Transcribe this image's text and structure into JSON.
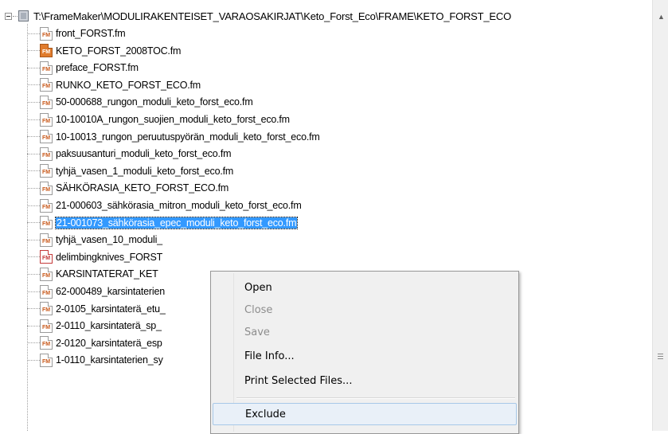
{
  "tree": {
    "root_path": "T:\\FrameMaker\\MODULIRAKENTEISET_VARAOSAKIRJAT\\Keto_Forst_Eco\\FRAME\\KETO_FORST_ECO",
    "files": [
      {
        "name": "front_FORST.fm",
        "icon": "fm-document-icon"
      },
      {
        "name": "KETO_FORST_2008TOC.fm",
        "icon": "fm-toc-icon"
      },
      {
        "name": "preface_FORST.fm",
        "icon": "fm-document-icon"
      },
      {
        "name": "RUNKO_KETO_FORST_ECO.fm",
        "icon": "fm-document-icon"
      },
      {
        "name": "50-000688_rungon_moduli_keto_forst_eco.fm",
        "icon": "fm-document-icon"
      },
      {
        "name": "10-10010A_rungon_suojien_moduli_keto_forst_eco.fm",
        "icon": "fm-document-icon"
      },
      {
        "name": "10-10013_rungon_peruutuspyörän_moduli_keto_forst_eco.fm",
        "icon": "fm-document-icon"
      },
      {
        "name": "paksuusanturi_moduli_keto_forst_eco.fm",
        "icon": "fm-document-icon"
      },
      {
        "name": "tyhjä_vasen_1_moduli_keto_forst_eco.fm",
        "icon": "fm-document-icon"
      },
      {
        "name": "SÄHKÖRASIA_KETO_FORST_ECO.fm",
        "icon": "fm-document-icon"
      },
      {
        "name": "21-000603_sähkörasia_mitron_moduli_keto_forst_eco.fm",
        "icon": "fm-document-icon"
      },
      {
        "name": "21-001073_sähkörasia_epec_moduli_keto_forst_eco.fm",
        "icon": "fm-document-icon",
        "selected": true
      },
      {
        "name": "tyhjä_vasen_10_moduli_",
        "icon": "fm-document-icon"
      },
      {
        "name": "delimbingknives_FORST",
        "icon": "fm-document-red-icon"
      },
      {
        "name": "KARSINTATERAT_KET",
        "icon": "fm-document-icon"
      },
      {
        "name": "62-000489_karsintaterien",
        "icon": "fm-document-icon"
      },
      {
        "name": "2-0105_karsintaterä_etu_",
        "icon": "fm-document-icon"
      },
      {
        "name": "2-0110_karsintaterä_sp_",
        "icon": "fm-document-icon"
      },
      {
        "name": "2-0120_karsintaterä_esp",
        "icon": "fm-document-icon"
      },
      {
        "name": "1-0110_karsintaterien_sy",
        "icon": "fm-document-icon"
      }
    ]
  },
  "context_menu": {
    "items": [
      {
        "label": "Open",
        "enabled": true
      },
      {
        "label": "Close",
        "enabled": false
      },
      {
        "label": "Save",
        "enabled": false
      },
      {
        "label": "File Info...",
        "enabled": true
      },
      {
        "label": "Print Selected Files...",
        "enabled": true
      },
      {
        "label": "Exclude",
        "enabled": true,
        "highlighted": true
      }
    ]
  },
  "colors": {
    "selection": "#3399ff",
    "menu_background": "#f0f0f0",
    "menu_hover": "#e9f0f8",
    "disabled_text": "#8d8d8d"
  }
}
